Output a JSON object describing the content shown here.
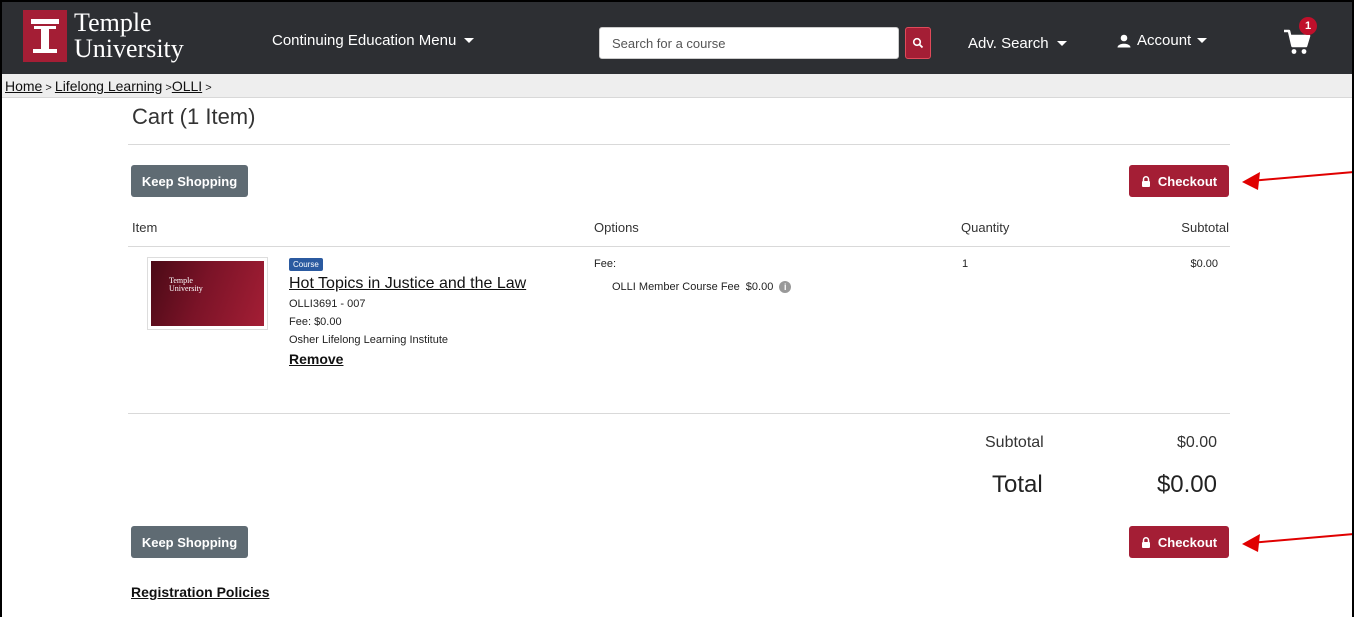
{
  "header": {
    "logo_line1": "Temple",
    "logo_line2": "University",
    "menu_label": "Continuing Education Menu",
    "search_placeholder": "Search for a course",
    "adv_search_label": "Adv. Search",
    "account_label": "Account",
    "cart_count": "1"
  },
  "breadcrumb": {
    "home": "Home",
    "sep1": " > ",
    "lifelong": "Lifelong Learning",
    "sep2": " >",
    "olli": "OLLI",
    "sep3": " >"
  },
  "cart": {
    "title": "Cart (1 Item)",
    "keep_shopping": "Keep Shopping",
    "checkout": "Checkout",
    "columns": [
      "Item",
      "Options",
      "Quantity",
      "Subtotal"
    ],
    "item": {
      "thumb_line1": "Temple",
      "thumb_line2": "University",
      "badge": "Course",
      "title": "Hot Topics in Justice and the Law",
      "code": "OLLI3691 - 007",
      "fee": "Fee: $0.00",
      "org": "Osher Lifelong Learning Institute",
      "remove": "Remove",
      "fee_label": "Fee:",
      "fee_option": "OLLI Member Course Fee",
      "fee_amount": "$0.00",
      "quantity": "1",
      "subtotal": "$0.00"
    },
    "summary": {
      "subtotal_label": "Subtotal",
      "subtotal_value": "$0.00",
      "total_label": "Total",
      "total_value": "$0.00"
    },
    "policies_link": "Registration Policies"
  },
  "colors": {
    "brand": "#a41e35",
    "header_bg": "#2d2f33",
    "button_gray": "#5f6b73",
    "annotation_arrow": "#e00000"
  }
}
